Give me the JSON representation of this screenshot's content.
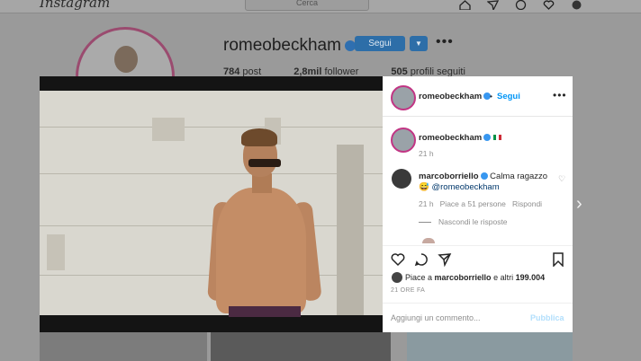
{
  "topbar": {
    "logo": "Instagram",
    "search_placeholder": "Cerca"
  },
  "profile": {
    "username": "romeobeckham",
    "follow_label": "Segui",
    "more": "•••",
    "stats": {
      "posts": "784",
      "posts_label": "post",
      "followers": "2,8mil",
      "followers_label": "follower",
      "following": "505",
      "following_label": "profili seguiti"
    }
  },
  "modal": {
    "header": {
      "username": "romeobeckham",
      "sep": "•",
      "follow": "Segui",
      "more": "•••"
    },
    "caption": {
      "username": "romeobeckham",
      "time": "21 h"
    },
    "comment": {
      "username": "marcoborriello",
      "text": "Calma ragazzo",
      "mention": "@romeobeckham",
      "emoji": "😅",
      "time": "21 h",
      "likes": "Piace a 51 persone",
      "reply": "Rispondi",
      "hide_replies": "Nascondi le risposte"
    },
    "likes_text": {
      "prefix": "Piace a ",
      "user": "marcoborriello",
      "rest": " e altri ",
      "count": "199.004"
    },
    "post_date": "21 ORE FA",
    "comment_placeholder": "Aggiungi un commento...",
    "publish": "Pubblica"
  },
  "colors": {
    "accent": "#0095f6",
    "follow_btn": "#2d6ea8",
    "text": "#262626",
    "muted": "#8e8e8e"
  }
}
